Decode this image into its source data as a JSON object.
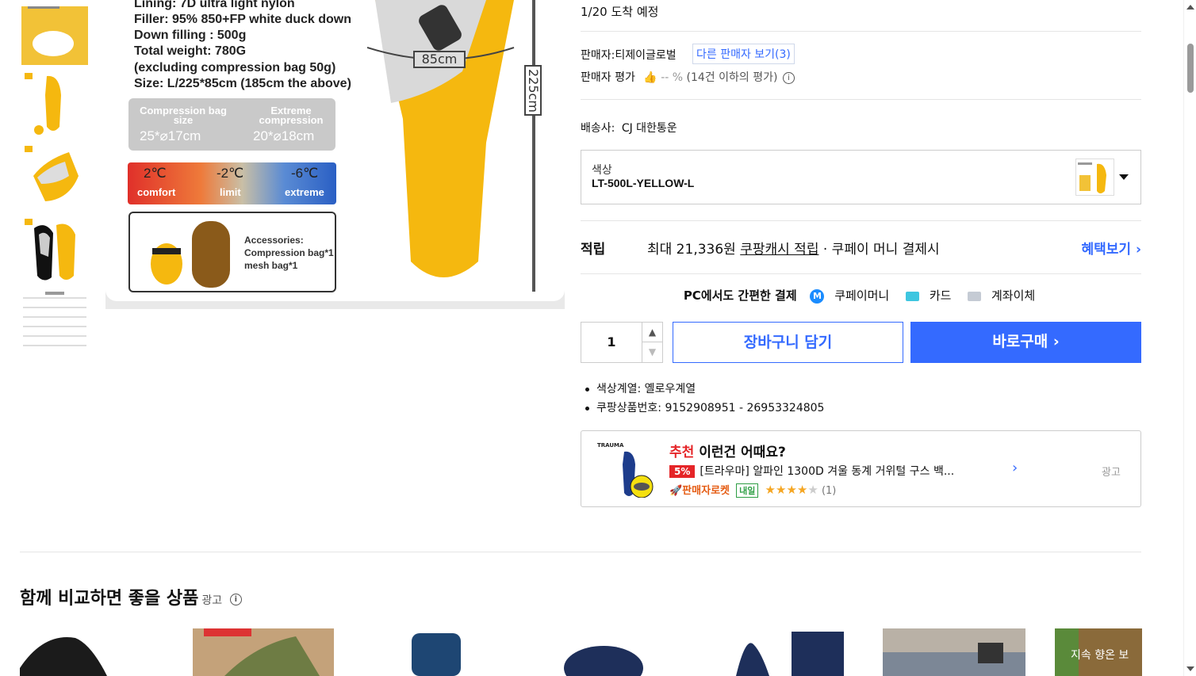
{
  "product_image": {
    "specs": [
      "Lining: 7D ultra light nylon",
      "Filler: 95% 850+FP white duck down",
      "Down filling : 500g",
      "Total weight: 780G",
      "(excluding compression bag 50g)",
      "Size: L/225*85cm (185cm the above)"
    ],
    "compression_label": "Compression bag size",
    "compression_value": "25*⌀17cm",
    "extreme_label": "Extreme compression",
    "extreme_value": "20*⌀18cm",
    "temps": [
      {
        "temp": "2℃",
        "name": "comfort"
      },
      {
        "temp": "-2℃",
        "name": "limit"
      },
      {
        "temp": "-6℃",
        "name": "extreme"
      }
    ],
    "accessories": [
      "Accessories:",
      "Compression bag*1",
      "mesh bag*1"
    ],
    "width_label": "85cm",
    "length_label": "225cm"
  },
  "delivery": {
    "eta": "1/20 도착 예정"
  },
  "seller": {
    "label": "판매자:",
    "name": "티제이글로벌",
    "other_sellers": "다른 판매자 보기(3)",
    "rating_label": "판매자 평가",
    "rating_value": "-- %",
    "rating_note": "(14건 이하의 평가)"
  },
  "shipping": {
    "label": "배송사:",
    "carrier": "CJ 대한통운"
  },
  "option": {
    "label": "색상",
    "value": "LT-500L-YELLOW-L"
  },
  "reward": {
    "title": "적립",
    "prefix": "최대 21,336원",
    "link": "쿠팡캐시 적립",
    "suffix": "· 쿠페이 머니 결제시",
    "more": "혜택보기 ›"
  },
  "payment": {
    "title": "PC에서도 간편한 결제",
    "methods": [
      "쿠페이머니",
      "카드",
      "계좌이체"
    ],
    "coupay_icon": "M"
  },
  "purchase": {
    "quantity": "1",
    "cart": "장바구니 담기",
    "buy": "바로구매 ›"
  },
  "attributes": [
    "색상계열: 옐로우계열",
    "쿠팡상품번호: 9152908951 - 26953324805"
  ],
  "recommendation": {
    "tag": "추천",
    "title": "이런건 어때요?",
    "discount": "5%",
    "name": "[트라우마] 알파인 1300D 겨울 동계 거위털 구스 백...",
    "rocket": "🚀판매자로켓",
    "tomorrow": "내일",
    "rating": 4,
    "review_count": "(1)",
    "ad": "광고",
    "brand": "TRAUMA"
  },
  "compare": {
    "title": "함께 비교하면 좋을 상품",
    "ad": "광고"
  },
  "colors": {
    "accent": "#346aff",
    "red": "#e52528",
    "bag_yellow": "#f5b80f"
  }
}
